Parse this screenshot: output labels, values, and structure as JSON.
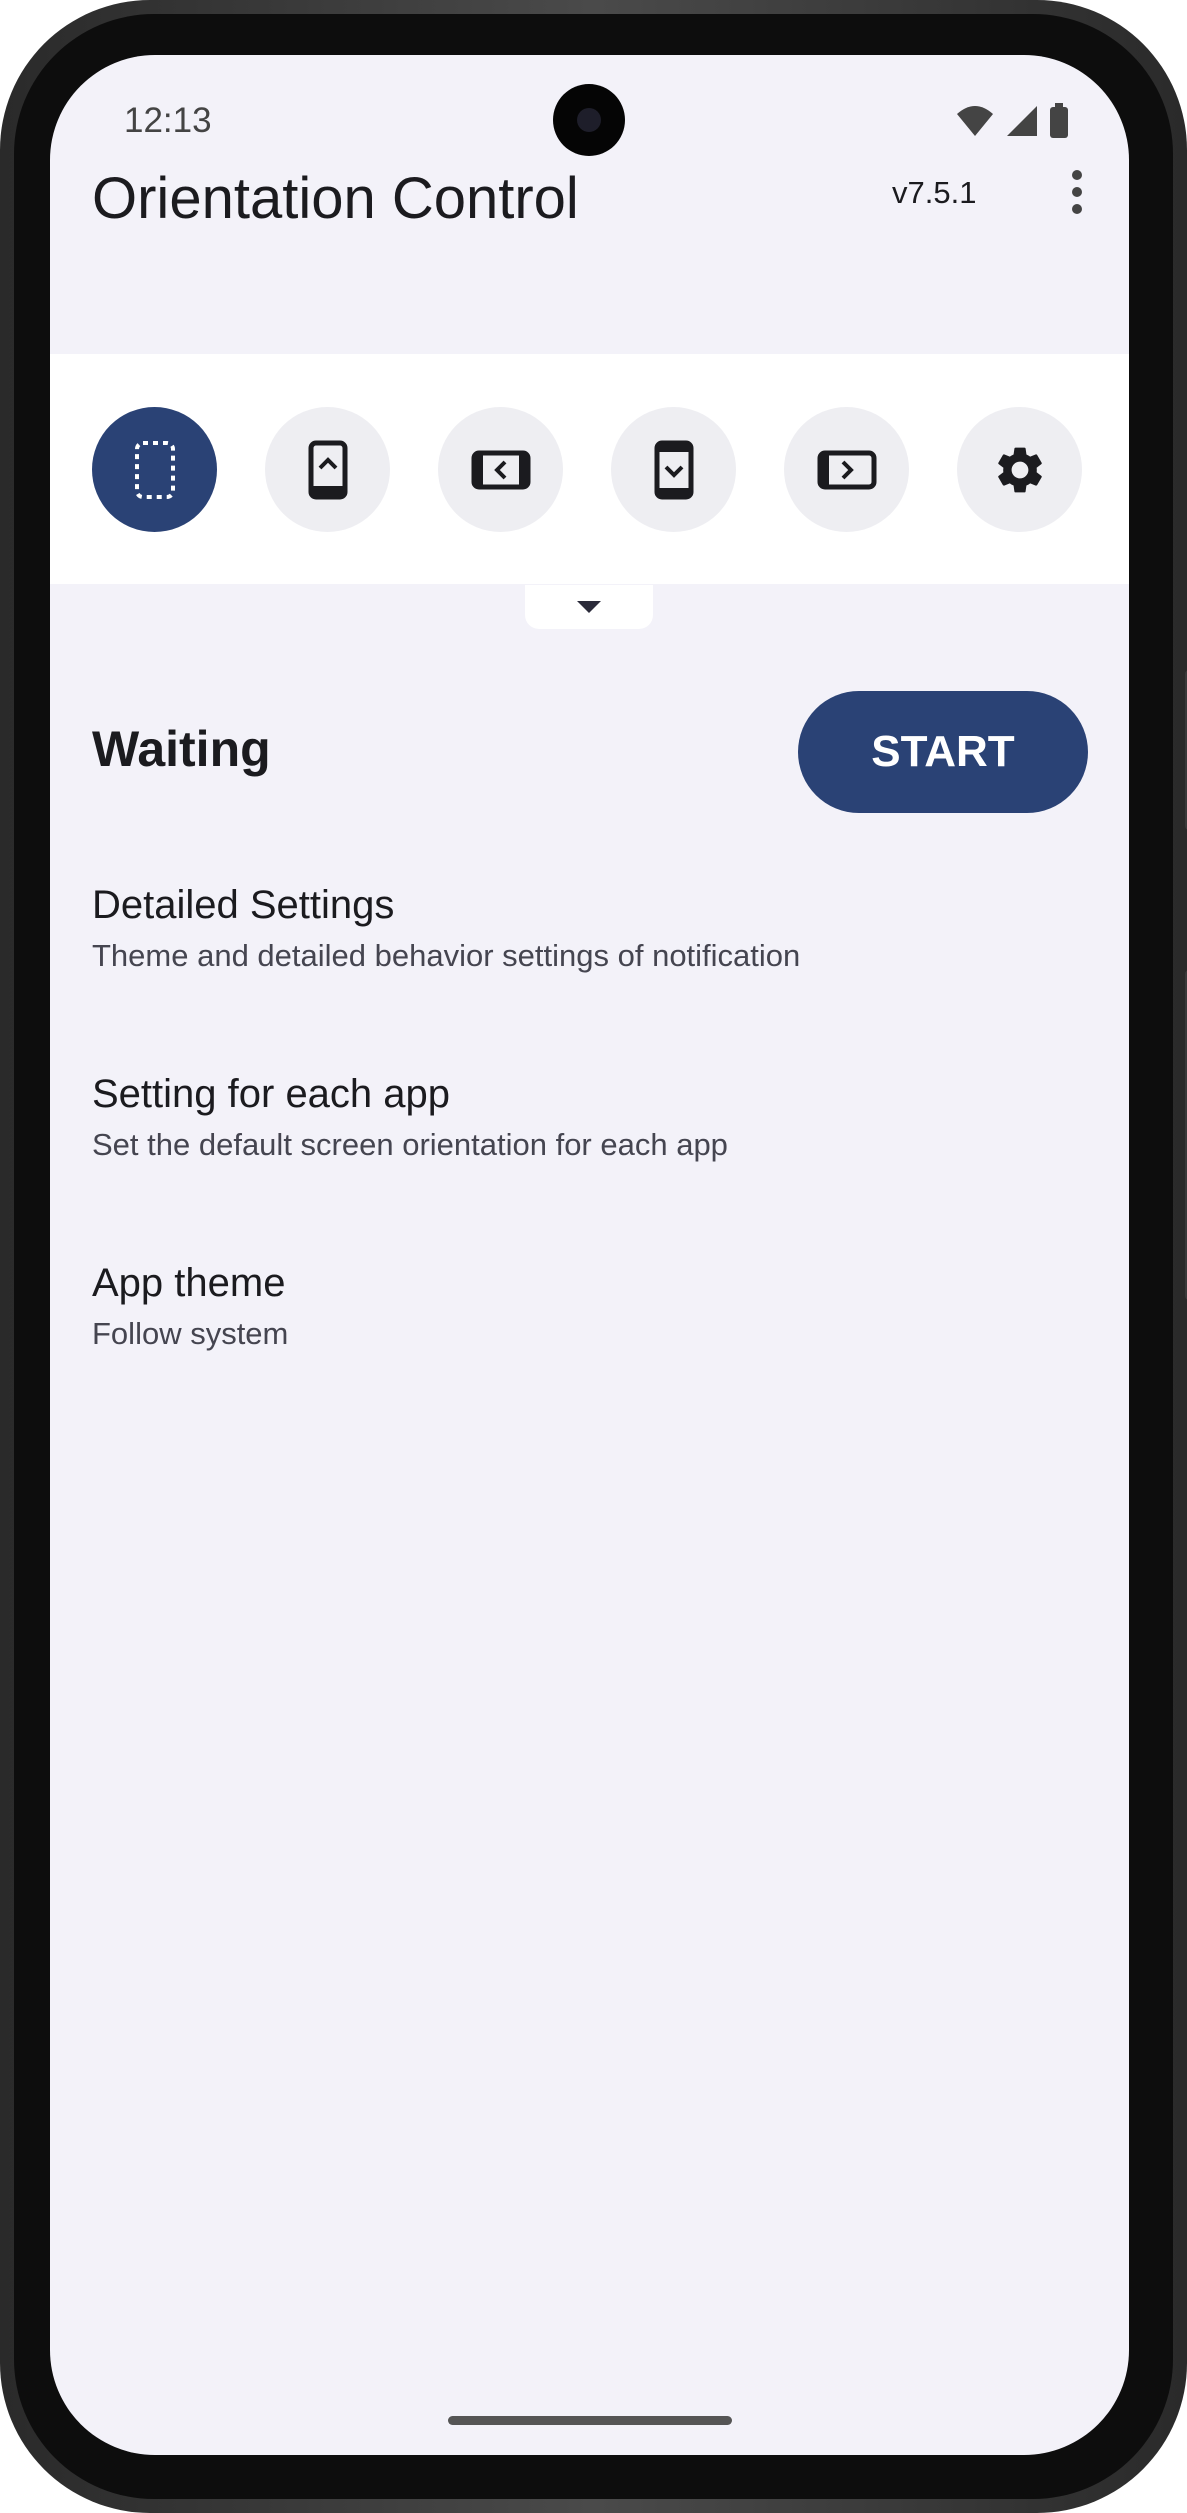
{
  "status_bar": {
    "time": "12:13",
    "icons": [
      "wifi-icon",
      "signal-icon",
      "battery-icon"
    ]
  },
  "app_bar": {
    "title": "Orientation Control",
    "version": "v7.5.1",
    "menu_icon": "more-vert-icon"
  },
  "orientation_buttons": [
    {
      "name": "unspecified-orientation",
      "icon": "dashed-phone-icon",
      "active": true
    },
    {
      "name": "portrait-orientation",
      "icon": "phone-portrait-up-icon",
      "active": false
    },
    {
      "name": "landscape-orientation",
      "icon": "phone-landscape-left-icon",
      "active": false
    },
    {
      "name": "reverse-portrait-orientation",
      "icon": "phone-portrait-down-icon",
      "active": false
    },
    {
      "name": "reverse-landscape-orientation",
      "icon": "phone-landscape-right-icon",
      "active": false
    },
    {
      "name": "settings",
      "icon": "gear-icon",
      "active": false
    }
  ],
  "colors": {
    "accent": "#2a4275",
    "background": "#f3f2f9",
    "surface": "#ffffff",
    "chip_bg": "#eeeef2"
  },
  "service": {
    "status": "Waiting",
    "start_label": "START"
  },
  "settings": [
    {
      "title": "Detailed Settings",
      "subtitle": "Theme and detailed behavior settings of notification"
    },
    {
      "title": "Setting for each app",
      "subtitle": "Set the default screen orientation for each app"
    },
    {
      "title": "App theme",
      "subtitle": "Follow system"
    }
  ]
}
